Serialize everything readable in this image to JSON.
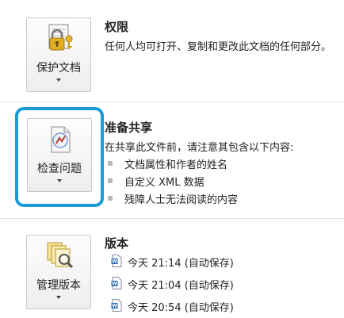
{
  "permissions": {
    "button_label": "保护文档",
    "title": "权限",
    "description": "任何人均可打开、复制和更改此文档的任何部分。"
  },
  "prepare": {
    "button_label": "检查问题",
    "title": "准备共享",
    "description": "在共享此文件前，请注意其包含以下内容:",
    "items": [
      "文档属性和作者的姓名",
      "自定义 XML 数据",
      "残障人士无法阅读的内容"
    ]
  },
  "versions": {
    "button_label": "管理版本",
    "title": "版本",
    "items": [
      "今天 21:14 (自动保存)",
      "今天 21:04 (自动保存)",
      "今天 20:54 (自动保存)"
    ]
  },
  "colors": {
    "focus_ring": "#1a9ad6",
    "lock": "#d4a017",
    "doc_icon": "#2b6cb0"
  },
  "icons": [
    "lock-document-icon",
    "inspect-document-icon",
    "manage-versions-icon",
    "word-doc-icon"
  ]
}
